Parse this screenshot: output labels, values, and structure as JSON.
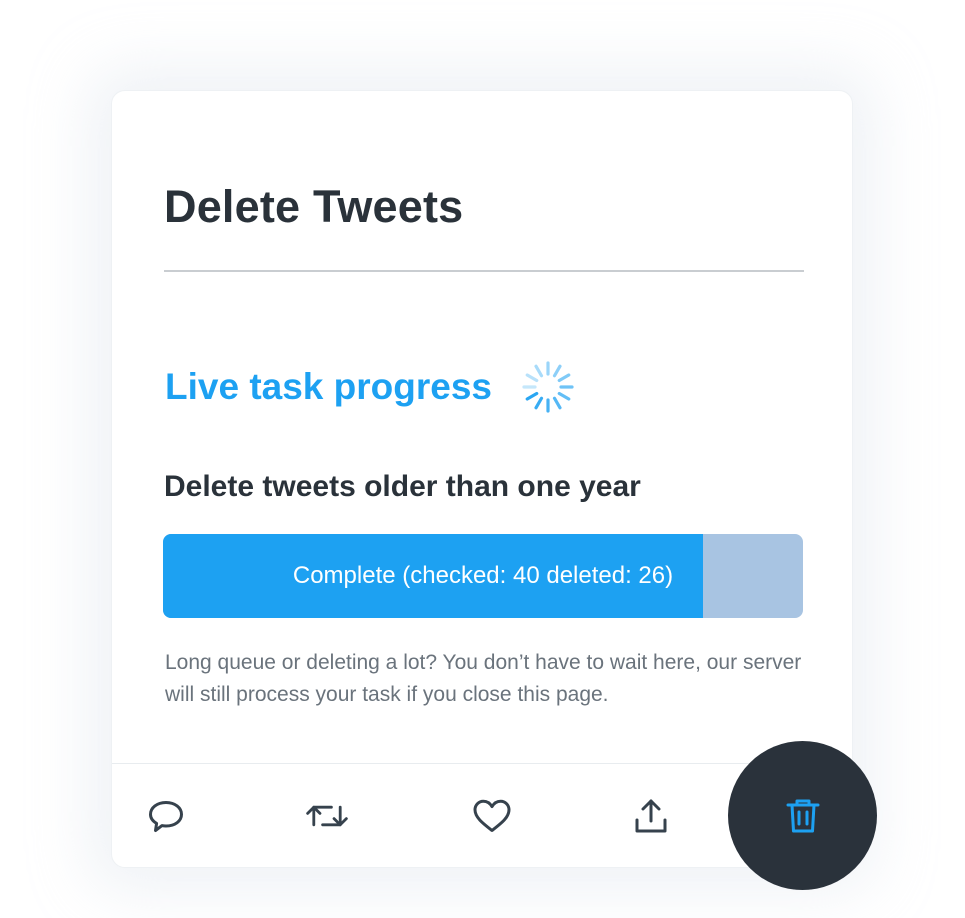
{
  "card": {
    "title": "Delete Tweets",
    "section_title": "Live task progress",
    "task": {
      "name": "Delete tweets older than one year",
      "progress_fraction": 0.843,
      "status_label": "Complete (checked: 40 deleted: 26)"
    },
    "note": "Long queue or deleting a lot? You don’t have to wait here, our server will still process your task if you close this page."
  },
  "actions": [
    {
      "icon": "reply-icon"
    },
    {
      "icon": "retweet-icon"
    },
    {
      "icon": "like-icon"
    },
    {
      "icon": "share-icon"
    }
  ],
  "fab": {
    "icon": "trash-icon"
  },
  "colors": {
    "accent": "#1da1f2",
    "progress_track": "#a8c4e2",
    "heading": "#2a323a",
    "muted_text": "#6a737c",
    "icon": "#36424d",
    "fab_bg": "#2a323b"
  }
}
